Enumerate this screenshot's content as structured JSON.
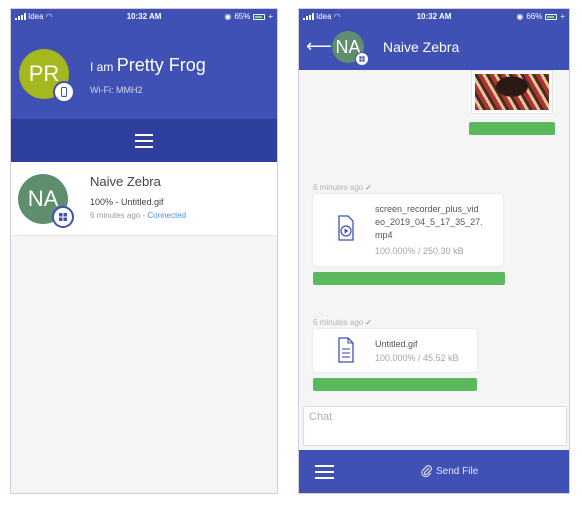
{
  "status_left": {
    "carrier": "Idea",
    "time": "10:32 AM",
    "battery": "65%"
  },
  "status_right": {
    "carrier": "Idea",
    "time": "10:32 AM",
    "battery": "66%"
  },
  "profile": {
    "initials": "PR",
    "prefix": "I am",
    "name": "Pretty Frog",
    "wifi": "Wi-Fi: MMH2",
    "avatar_color": "#a5b81d",
    "device_icon": "phone-icon"
  },
  "peer": {
    "initials": "NA",
    "name": "Naive Zebra",
    "file_status": "100% - Untitled.gif",
    "time_ago": "6 minutes ago",
    "separator": " - ",
    "connection": "Connected",
    "avatar_color": "#5e8e6e",
    "device_icon": "windows-icon"
  },
  "chat": {
    "title": "Naive Zebra",
    "messages": [
      {
        "type": "image",
        "progress": 1.0
      },
      {
        "type": "file",
        "timestamp": "6 minutes ago",
        "name_lines": [
          "screen_recorder_plus_vid",
          "eo_2019_04_5_17_35_27.",
          "mp4"
        ],
        "size": "100.000% / 250.30 kB",
        "icon": "video-file-icon",
        "progress": 1.0
      },
      {
        "type": "file",
        "timestamp": "6 minutes ago",
        "name_lines": [
          "Untitled.gif"
        ],
        "size": "100.000% / 45.52 kB",
        "icon": "document-file-icon",
        "progress": 1.0
      }
    ],
    "input_placeholder": "Chat",
    "send_file_label": "Send File"
  },
  "colors": {
    "primary": "#3f51b5",
    "primary_dark": "#2f3f9e",
    "progress": "#5cb85c",
    "link": "#4a90e2"
  }
}
